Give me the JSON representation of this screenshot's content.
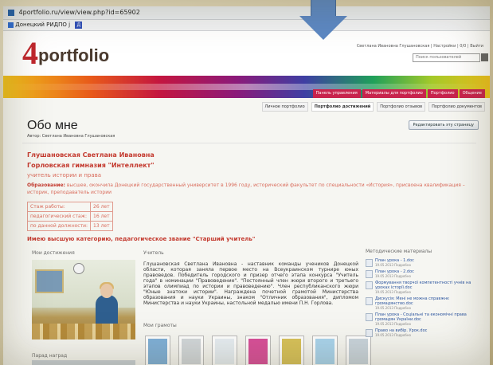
{
  "browser": {
    "url": "4portfolio.ru/view/view.php?id=65902",
    "bookmark": "Донецкий РИДПО ј",
    "bookmark_badge": "Д"
  },
  "header": {
    "logo_four": "4",
    "logo_word": "portfolio",
    "user_links": "Светлана Ивановна Глушановская | Настройки | 0/0 | Выйти",
    "search_placeholder": "Поиск пользователей"
  },
  "nav": {
    "items": [
      {
        "label": "Панель управления",
        "color": "#c8234d"
      },
      {
        "label": "Материалы для портфолио",
        "color": "#c8234d"
      },
      {
        "label": "Портфолио",
        "color": "#c8234d"
      },
      {
        "label": "Общение",
        "color": "#c8234d"
      }
    ]
  },
  "subtabs": [
    {
      "label": "Личное портфолио",
      "active": false
    },
    {
      "label": "Портфолио достижений",
      "active": true
    },
    {
      "label": "Портфолио отзывов",
      "active": false
    },
    {
      "label": "Портфолио документов",
      "active": false
    }
  ],
  "page": {
    "title": "Обо мне",
    "author": "Автор: Светлана Ивановна Глушановская",
    "edit_button": "Редактировать эту страницу"
  },
  "profile": {
    "name": "Глушановская Светлана Ивановна",
    "school": "Горловская гимназия \"Интеллект\"",
    "role": "учитель истории и права",
    "education_label": "Образование:",
    "education_text": "высшее, окончила Донецкий государственный университет в 1996 году, исторический факультет по специальности «История», присвоена квалификация – историк, преподаватель истории",
    "experience": [
      {
        "label": "Стаж работы:",
        "value": "26 лет"
      },
      {
        "label": "педагогический стаж:",
        "value": "16 лет"
      },
      {
        "label": "по данной должности:",
        "value": "13 лет"
      }
    ],
    "category": "Имею высшую категорию, педагогическое звание \"Старший учитель\""
  },
  "sections": {
    "achievements_title": "Мои достижения",
    "teacher_title": "Учитель",
    "methods_title": "Методические материалы",
    "grants_title": "Мои грамоты",
    "gallery_title": "Парад наград"
  },
  "bio": "Глушановская Светлана Ивановна - наставник команды учеников Донецкой области, которая заняла первое место на Всеукраинском турнире юных правоведов. Победитель городского и призер отчего этапа конкурса \"Учитель года\" в номинации \"Правоведение\". \"Постоянный член жюри второго и третьего этапов олимпиад по истории и правоведению\". Член республиканского жюри \"Юные знатоки истории\". Награждена почетной грамотой Министерства образования и науки Украины, знаком \"Отличник образования\", дипломом Министерства и науки Украины, настольной медалью имени П.Н. Горлова.",
  "methods": [
    {
      "title": "План урока - 1.doc",
      "meta": "19.05.2013 Подробно"
    },
    {
      "title": "План урока - 2.doc",
      "meta": "19.05.2013 Подробно"
    },
    {
      "title": "Формування творчої компетентності учнів на уроках історії.doc",
      "meta": "19.05.2013 Подробно"
    },
    {
      "title": "Дискусія: Мені не можна справжнє громадянство.doc",
      "meta": "19.05.2013 Подробно"
    },
    {
      "title": "План урока - Соціальні та економічні права громадян України.doc",
      "meta": "19.05.2013 Подробно"
    },
    {
      "title": "Право на вибір. Урок.doc",
      "meta": "19.05.2013 Подробно"
    }
  ],
  "grants": [
    {
      "name": "certificate-1",
      "color": "#7fb0d9"
    },
    {
      "name": "certificate-2",
      "color": "#d2d7db"
    },
    {
      "name": "certificate-3",
      "color": "#e7eef4"
    },
    {
      "name": "certificate-4",
      "color": "#d94f9a"
    },
    {
      "name": "certificate-5",
      "color": "#d8c25a"
    },
    {
      "name": "certificate-6",
      "color": "#a9d4ee"
    },
    {
      "name": "certificate-7",
      "color": "#c9d4dd"
    }
  ]
}
